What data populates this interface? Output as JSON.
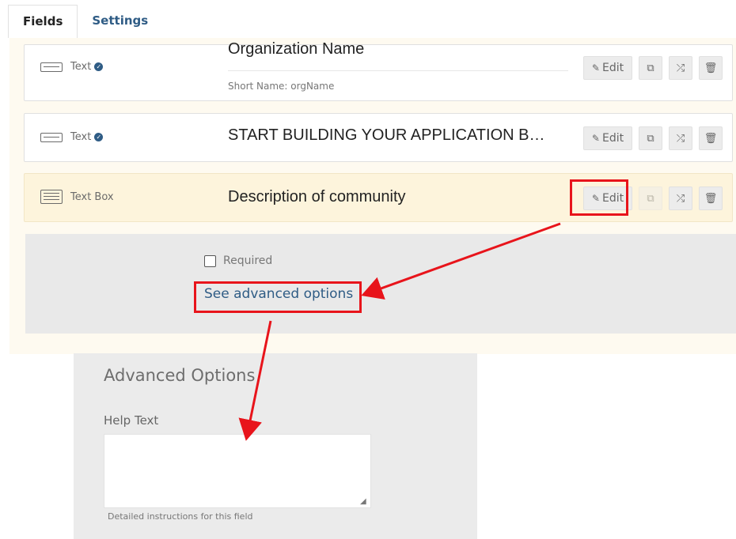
{
  "tabs": [
    {
      "label": "Fields",
      "active": true
    },
    {
      "label": "Settings",
      "active": false
    }
  ],
  "fields": [
    {
      "type_label": "Text",
      "type_icon": "text-field-icon",
      "verified_icon": "check-circle-icon",
      "name": "Organization Name",
      "short_name": "Short Name: orgName"
    },
    {
      "type_label": "Text",
      "type_icon": "text-field-icon",
      "verified_icon": "check-circle-icon",
      "name": "START BUILDING YOUR APPLICATION B…"
    },
    {
      "type_label": "Text Box",
      "type_icon": "text-box-icon",
      "name": "Description of community"
    }
  ],
  "actions": {
    "edit_label": "Edit",
    "edit_icon": "edit-icon",
    "copy_icon": "copy-icon",
    "move_icon": "shuffle-icon",
    "delete_icon": "trash-icon"
  },
  "expanded": {
    "required_label": "Required",
    "required_checked": false,
    "advanced_link": "See advanced options"
  },
  "advanced_options": {
    "title": "Advanced Options",
    "help_text_label": "Help Text",
    "help_text_value": "",
    "help_text_hint": "Detailed instructions for this field"
  },
  "colors": {
    "annotation_red": "#e8141b",
    "link_blue": "#2f5c85",
    "highlight_row": "#fdf4dc"
  }
}
